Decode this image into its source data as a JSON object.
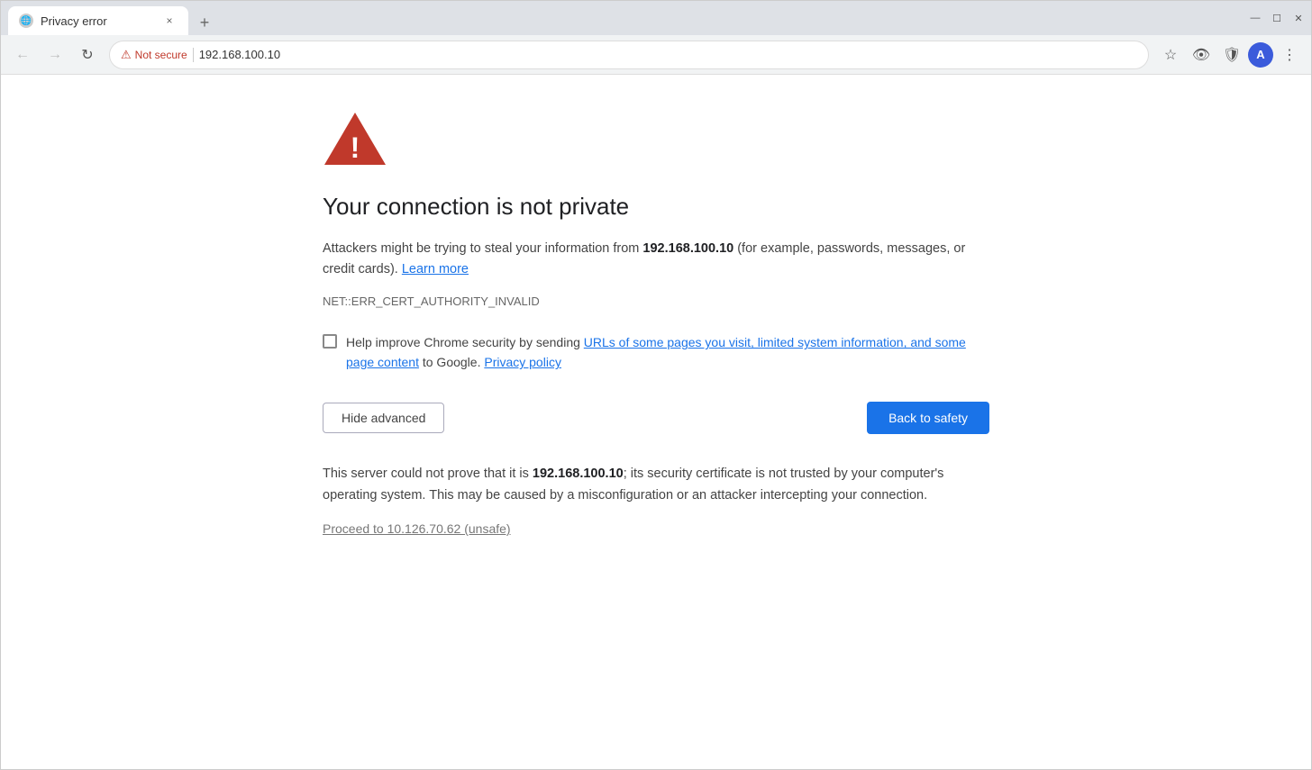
{
  "browser": {
    "tab": {
      "favicon": "🌐",
      "title": "Privacy error",
      "close_label": "×"
    },
    "new_tab_label": "+",
    "window_controls": {
      "minimize": "—",
      "maximize": "☐",
      "close": "✕"
    },
    "nav": {
      "back_label": "←",
      "forward_label": "→",
      "reload_label": "↻"
    },
    "address_bar": {
      "not_secure_label": "Not secure",
      "url": "192.168.100.10"
    },
    "toolbar_icons": {
      "star": "☆",
      "extension1": "👁",
      "extension2": "🛡",
      "avatar_label": "A",
      "menu": "⋮"
    }
  },
  "page": {
    "error_title": "Your connection is not private",
    "description_prefix": "Attackers might be trying to steal your information from ",
    "target_host": "192.168.100.10",
    "description_middle": " (for example, passwords, messages, or credit cards). ",
    "learn_more_label": "Learn more",
    "error_code": "NET::ERR_CERT_AUTHORITY_INVALID",
    "checkbox_prefix": "Help improve Chrome security by sending ",
    "checkbox_link": "URLs of some pages you visit, limited system information, and some page content",
    "checkbox_suffix": " to Google. ",
    "privacy_policy_label": "Privacy policy",
    "hide_advanced_label": "Hide advanced",
    "back_to_safety_label": "Back to safety",
    "advanced_prefix": "This server could not prove that it is ",
    "advanced_host": "192.168.100.10",
    "advanced_suffix": "; its security certificate is not trusted by your computer's operating system. This may be caused by a misconfiguration or an attacker intercepting your connection.",
    "proceed_label": "Proceed to 10.126.70.62 (unsafe)"
  }
}
